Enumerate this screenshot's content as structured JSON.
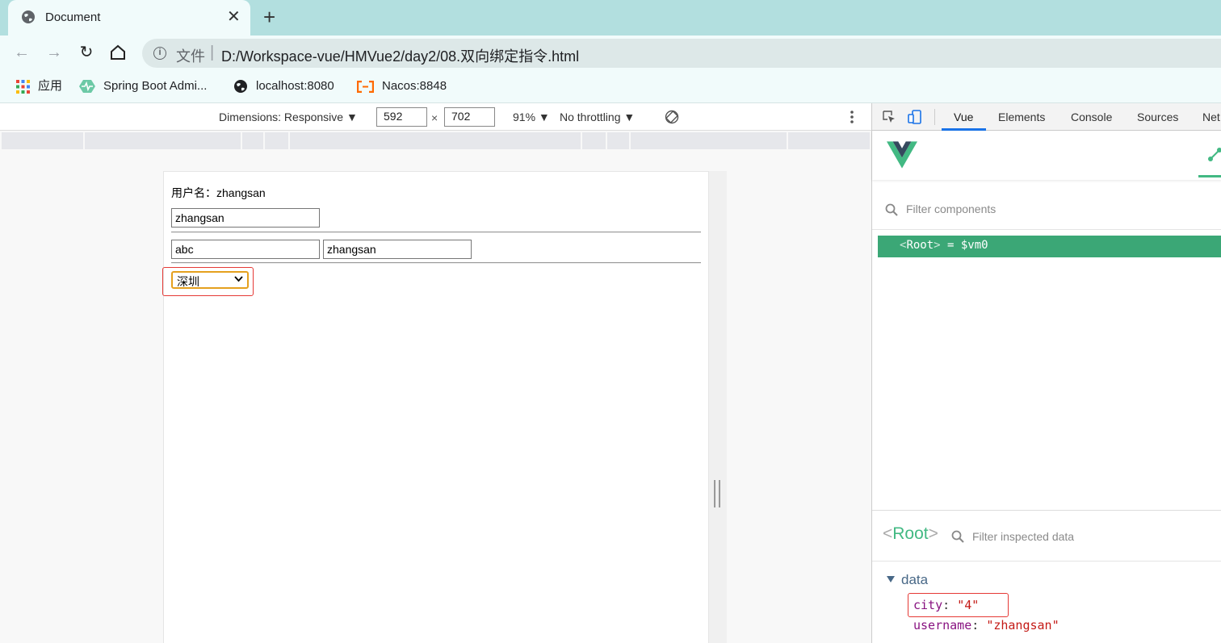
{
  "browser": {
    "tab": {
      "title": "Document"
    },
    "address": {
      "scheme_label": "文件",
      "url": "D:/Workspace-vue/HMVue2/day2/08.双向绑定指令.html"
    },
    "bookmarks": [
      {
        "label": "应用",
        "icon": "apps-grid-icon"
      },
      {
        "label": "Spring Boot Admi...",
        "icon": "spring-boot-admin-icon"
      },
      {
        "label": "localhost:8080",
        "icon": "globe-icon"
      },
      {
        "label": "Nacos:8848",
        "icon": "nacos-icon"
      }
    ]
  },
  "device_toolbar": {
    "dimensions_label": "Dimensions: Responsive ▼",
    "width": "592",
    "times": "×",
    "height": "702",
    "zoom": "91% ▼",
    "throttling": "No throttling ▼"
  },
  "page": {
    "username_text": "用户名：zhangsan",
    "input1_value": "zhangsan",
    "input2_value": "abc",
    "input3_value": "zhangsan",
    "select_value": "深圳"
  },
  "devtools": {
    "tabs": [
      "Vue",
      "Elements",
      "Console",
      "Sources",
      "Net"
    ],
    "active_tab": "Vue",
    "filter_components_placeholder": "Filter components",
    "root_row": {
      "open": "<",
      "name": "Root",
      "close": ">",
      "assign": " = $vm0"
    },
    "inspector": {
      "title_open": "<",
      "title_name": "Root",
      "title_close": ">",
      "filter_placeholder": "Filter inspected data",
      "section": "data",
      "props": [
        {
          "key": "city",
          "value": "\"4\""
        },
        {
          "key": "username",
          "value": "\"zhangsan\""
        }
      ]
    }
  },
  "colors": {
    "vue_green": "#42b983",
    "highlight_red": "#e53935",
    "select_focus": "#e5a01e",
    "devtools_active_blue": "#1a73e8"
  }
}
